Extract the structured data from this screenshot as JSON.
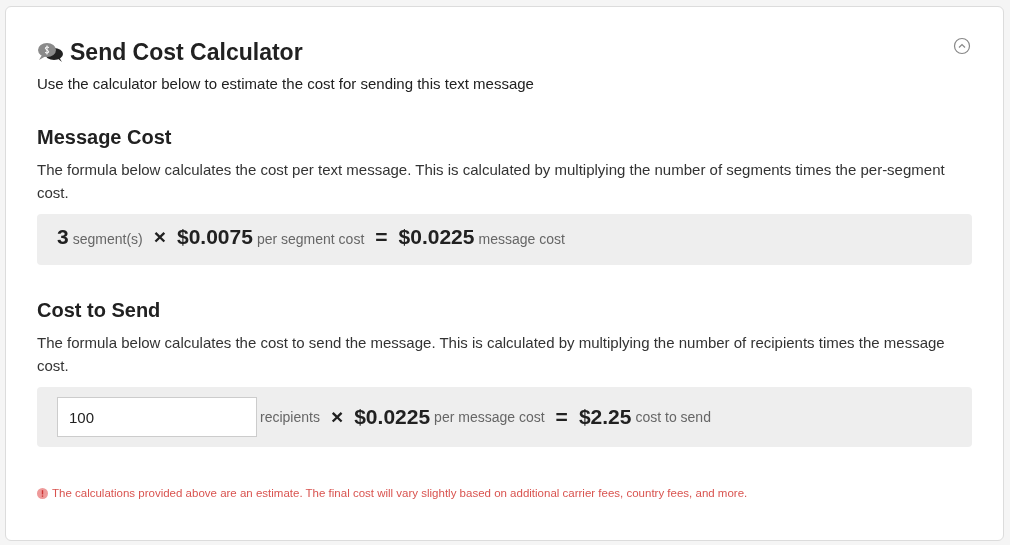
{
  "title": "Send Cost Calculator",
  "subtitle": "Use the calculator below to estimate the cost for sending this text message",
  "sections": [
    {
      "heading": "Message Cost",
      "description": "The formula below calculates the cost per text message. This is calculated by multiplying the number of segments times the per-segment cost.",
      "formula": [
        {
          "kind": "number",
          "text": "3"
        },
        {
          "kind": "unit",
          "text": "segment(s)"
        },
        {
          "kind": "operator",
          "text": "×"
        },
        {
          "kind": "number",
          "text": "$0.0075"
        },
        {
          "kind": "unit",
          "text": "per segment cost"
        },
        {
          "kind": "operator",
          "text": "="
        },
        {
          "kind": "number",
          "text": "$0.0225"
        },
        {
          "kind": "unit",
          "text": "message cost"
        }
      ]
    },
    {
      "heading": "Cost to Send",
      "description": "The formula below calculates the cost to send the message. This is calculated by multiplying the number of recipients times the message cost.",
      "formula": [
        {
          "kind": "input",
          "text": "100"
        },
        {
          "kind": "unit",
          "text": "recipients"
        },
        {
          "kind": "operator",
          "text": "×"
        },
        {
          "kind": "number",
          "text": "$0.0225"
        },
        {
          "kind": "unit",
          "text": "per message cost"
        },
        {
          "kind": "operator",
          "text": "="
        },
        {
          "kind": "number",
          "text": "$2.25"
        },
        {
          "kind": "unit",
          "text": "cost to send"
        }
      ]
    }
  ],
  "note": "The calculations provided above are an estimate. The final cost will vary slightly based on additional carrier fees, country fees, and more."
}
